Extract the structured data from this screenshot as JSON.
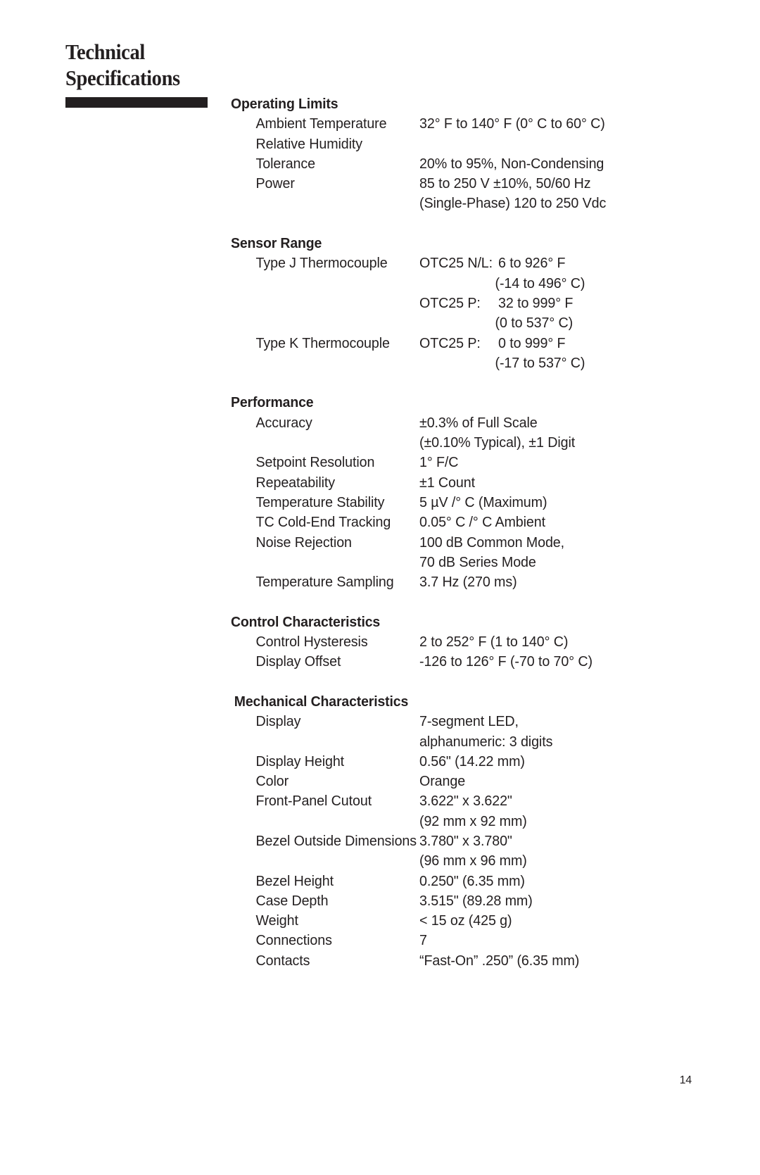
{
  "document": {
    "title": "Technical\nSpecifications",
    "page_number": "14",
    "rule_color": "#231f20",
    "text_color": "#231f20"
  },
  "sections": [
    {
      "heading": "Operating Limits",
      "rows": [
        {
          "label": "Ambient Temperature",
          "prefix": "",
          "value": "32° F to 140° F (0° C to 60° C)"
        },
        {
          "label": "Relative Humidity",
          "prefix": "",
          "value": ""
        },
        {
          "label": "Tolerance",
          "prefix": "",
          "value": "20% to 95%, Non-Condensing"
        },
        {
          "label": "Power",
          "prefix": "",
          "value": "85 to 250 V ±10%, 50/60 Hz"
        },
        {
          "label": "",
          "prefix": "",
          "value": "(Single-Phase) 120 to 250 Vdc"
        }
      ]
    },
    {
      "heading": "Sensor Range",
      "rows": [
        {
          "label": "Type J Thermocouple",
          "prefix": "OTC25 N/L:",
          "value": "6 to 926° F"
        },
        {
          "label": "",
          "prefix": "",
          "value": "(-14 to 496° C)",
          "sub": true
        },
        {
          "label": "",
          "prefix": "OTC25 P:",
          "value": "32 to 999° F"
        },
        {
          "label": "",
          "prefix": "",
          "value": "(0 to 537° C)",
          "sub": true
        },
        {
          "label": "Type K Thermocouple",
          "prefix": "OTC25 P:",
          "value": "0 to 999° F"
        },
        {
          "label": "",
          "prefix": "",
          "value": "(-17 to 537° C)",
          "sub": true
        }
      ]
    },
    {
      "heading": "Performance",
      "rows": [
        {
          "label": "Accuracy",
          "prefix": "",
          "value": "±0.3% of Full Scale"
        },
        {
          "label": "",
          "prefix": "",
          "value": "(±0.10% Typical), ±1 Digit"
        },
        {
          "label": "Setpoint Resolution",
          "prefix": "",
          "value": "1° F/C"
        },
        {
          "label": "Repeatability",
          "prefix": "",
          "value": "±1 Count"
        },
        {
          "label": "Temperature Stability",
          "prefix": "",
          "value": "5 µV /° C (Maximum)"
        },
        {
          "label": "TC Cold-End Tracking",
          "prefix": "",
          "value": "0.05° C /° C Ambient"
        },
        {
          "label": "Noise Rejection",
          "prefix": "",
          "value": "100 dB Common Mode,"
        },
        {
          "label": "",
          "prefix": "",
          "value": "70 dB Series Mode"
        },
        {
          "label": "Temperature Sampling",
          "prefix": "",
          "value": "3.7 Hz (270 ms)"
        }
      ]
    },
    {
      "heading": "Control Characteristics",
      "rows": [
        {
          "label": "Control Hysteresis",
          "prefix": "",
          "value": "2 to 252° F (1 to 140° C)"
        },
        {
          "label": "Display Offset",
          "prefix": "",
          "value": "-126 to 126° F (-70 to 70° C)"
        }
      ]
    },
    {
      "heading": "Mechanical Characteristics",
      "heading_nudge": true,
      "rows": [
        {
          "label": "Display",
          "prefix": "",
          "value": "7-segment LED,"
        },
        {
          "label": "",
          "prefix": "",
          "value": "alphanumeric: 3 digits"
        },
        {
          "label": "Display Height",
          "prefix": "",
          "value": "0.56\" (14.22 mm)"
        },
        {
          "label": "Color",
          "prefix": "",
          "value": "Orange"
        },
        {
          "label": "Front-Panel Cutout",
          "prefix": "",
          "value": "3.622\" x 3.622\""
        },
        {
          "label": "",
          "prefix": "",
          "value": "(92 mm x 92 mm)"
        },
        {
          "label": "Bezel Outside Dimensions",
          "prefix": "",
          "value": "3.780\" x 3.780\""
        },
        {
          "label": "",
          "prefix": "",
          "value": "(96 mm x 96 mm)"
        },
        {
          "label": "Bezel Height",
          "prefix": "",
          "value": "0.250\" (6.35 mm)"
        },
        {
          "label": "Case Depth",
          "prefix": "",
          "value": "3.515\" (89.28 mm)"
        },
        {
          "label": "Weight",
          "prefix": "",
          "value": "< 15 oz (425 g)"
        },
        {
          "label": "Connections",
          "prefix": "",
          "value": "7"
        },
        {
          "label": "Contacts",
          "prefix": "",
          "value": "“Fast-On” .250” (6.35 mm)"
        }
      ]
    }
  ]
}
